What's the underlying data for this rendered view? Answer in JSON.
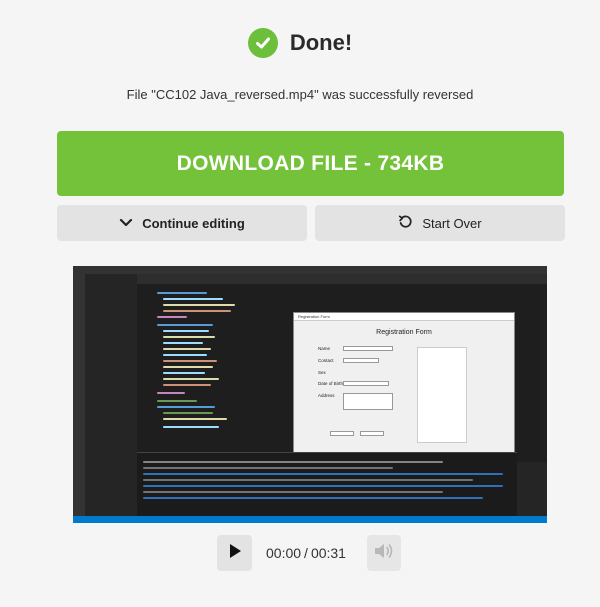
{
  "status": {
    "title": "Done!",
    "message": "File \"CC102 Java_reversed.mp4\" was successfully reversed"
  },
  "actions": {
    "download_label": "DOWNLOAD FILE - 734KB",
    "continue_label": "Continue editing",
    "start_over_label": "Start Over"
  },
  "preview": {
    "form_window_title": "Registration Form",
    "form_heading": "Registration Form",
    "fields": [
      "Name",
      "Contact",
      "Sex",
      "Date of Birth",
      "Address"
    ]
  },
  "player": {
    "current_time": "00:00",
    "separator": "/",
    "duration": "00:31"
  },
  "icons": {
    "success": "check-circle-icon",
    "continue": "chevron-down-icon",
    "start_over": "rotate-ccw-icon",
    "play": "play-icon",
    "volume": "volume-icon"
  },
  "colors": {
    "success_green": "#6cbf3a",
    "download_green": "#74c13a",
    "secondary_button": "#e3e3e3",
    "background": "#f5f5f5"
  }
}
